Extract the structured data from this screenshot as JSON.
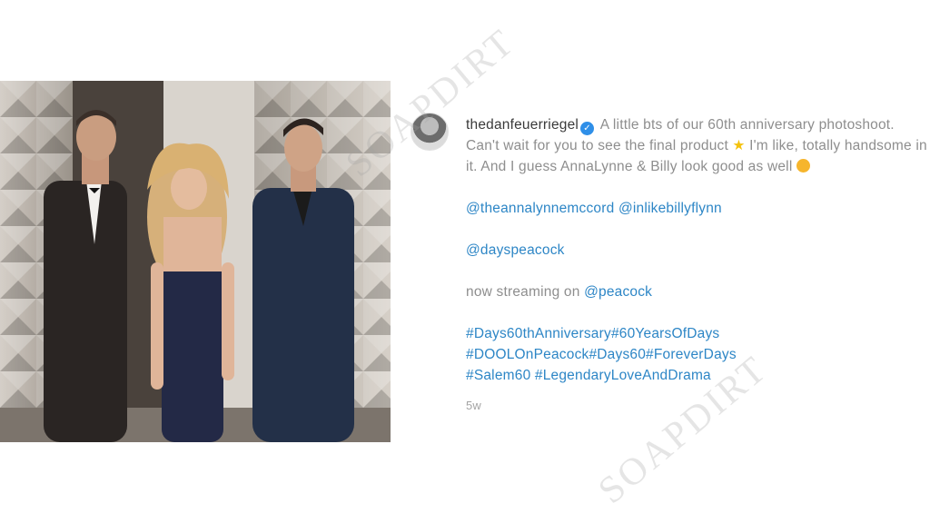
{
  "post": {
    "username": "thedanfeuerriegel",
    "verified_icon": "verified-badge-icon",
    "caption_part1": " A little bts of our 60th anniversary photoshoot. Can't wait for you to see the final product ",
    "caption_part2": " I'm like, totally handsome in it. And I guess AnnaLynne & Billy look good as well ",
    "mentions_line1_a": "@theannalynnemccord",
    "mentions_line1_b": "@inlikebillyflynn",
    "mention_line2": "@dayspeacock",
    "streaming_text": "now streaming on ",
    "streaming_link": "@peacock",
    "hashtags_line1": "#Days60thAnniversary#60YearsOfDays",
    "hashtags_line2": "#DOOLOnPeacock#Days60#ForeverDays",
    "hashtags_line3": "#Salem60 #LegendaryLoveAndDrama",
    "time_ago": "5w"
  },
  "watermark": "SOAPDIRT",
  "colors": {
    "link": "#2d86c6",
    "text": "#8e8e8e",
    "verified": "#2f8fe8"
  }
}
